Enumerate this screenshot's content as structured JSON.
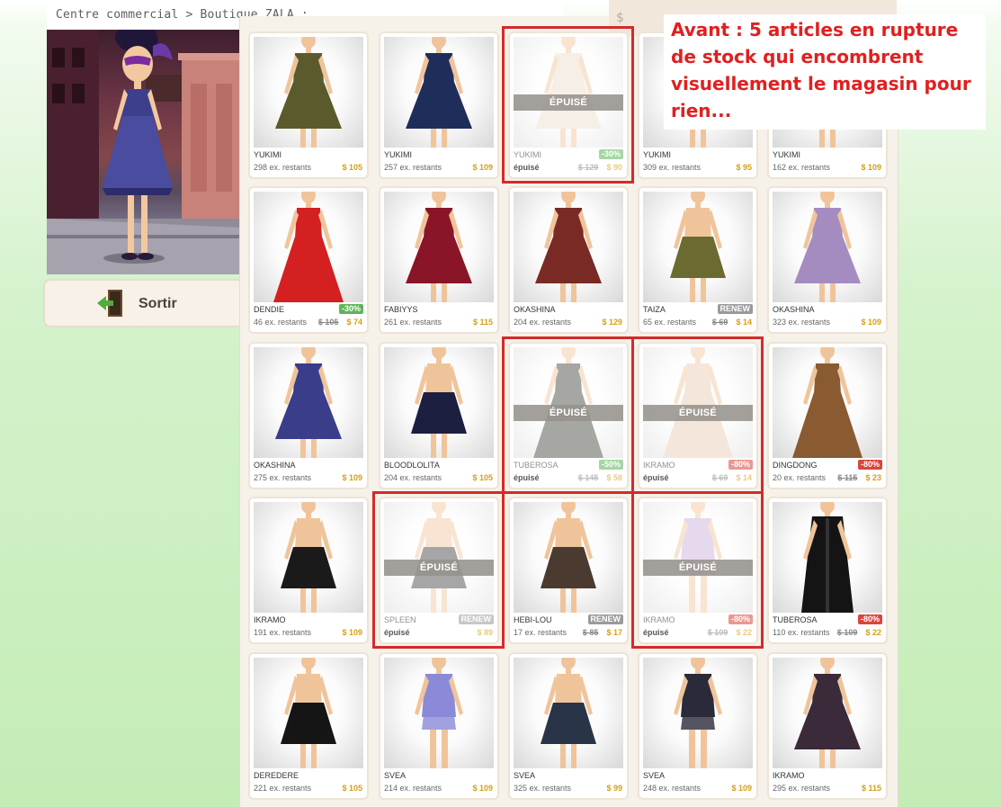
{
  "breadcrumb": "Centre commercial > Boutique ZALA :",
  "exit": {
    "label": "Sortir"
  },
  "top_widget": {
    "symbol": "$"
  },
  "annotation": "Avant : 5 articles en rupture de stock qui encombrent visuellement le magasin pour rien...",
  "sold_out_label": "ÉPUISÉ",
  "products": [
    {
      "name": "YUKIMI",
      "stock": "298 ex. restants",
      "price": "$ 105",
      "old_price": "",
      "badge": "",
      "badge_color": "",
      "sold_out": false,
      "garment": "dress",
      "color": "#5b5a2c"
    },
    {
      "name": "YUKIMI",
      "stock": "257 ex. restants",
      "price": "$ 109",
      "old_price": "",
      "badge": "",
      "badge_color": "",
      "sold_out": false,
      "garment": "dress",
      "color": "#1f2d5a"
    },
    {
      "name": "YUKIMI",
      "stock": "épuisé",
      "price": "$ 90",
      "old_price": "$ 129",
      "badge": "-30%",
      "badge_color": "green",
      "sold_out": true,
      "garment": "dress",
      "color": "#e8dcc8"
    },
    {
      "name": "YUKIMI",
      "stock": "309 ex. restants",
      "price": "$ 95",
      "old_price": "",
      "badge": "",
      "badge_color": "",
      "sold_out": false,
      "garment": "dress",
      "color": "#4d6a9a"
    },
    {
      "name": "YUKIMI",
      "stock": "162 ex. restants",
      "price": "$ 109",
      "old_price": "",
      "badge": "",
      "badge_color": "",
      "sold_out": false,
      "garment": "dress",
      "color": "#8a6b4a"
    },
    {
      "name": "DENDIE",
      "stock": "46 ex. restants",
      "price": "$ 74",
      "old_price": "$ 105",
      "badge": "-30%",
      "badge_color": "green",
      "sold_out": false,
      "garment": "gown",
      "color": "#d42020"
    },
    {
      "name": "FABIYYS",
      "stock": "261 ex. restants",
      "price": "$ 115",
      "old_price": "",
      "badge": "",
      "badge_color": "",
      "sold_out": false,
      "garment": "dress",
      "color": "#8a1528"
    },
    {
      "name": "OKASHINA",
      "stock": "204 ex. restants",
      "price": "$ 129",
      "old_price": "",
      "badge": "",
      "badge_color": "",
      "sold_out": false,
      "garment": "dress",
      "color": "#7a2a24"
    },
    {
      "name": "TAIZA",
      "stock": "65 ex. restants",
      "price": "$ 14",
      "old_price": "$ 69",
      "badge": "RENEW",
      "badge_color": "grey",
      "sold_out": false,
      "garment": "skirt",
      "color": "#6b6a30"
    },
    {
      "name": "OKASHINA",
      "stock": "323 ex. restants",
      "price": "$ 109",
      "old_price": "",
      "badge": "",
      "badge_color": "",
      "sold_out": false,
      "garment": "dress",
      "color": "#a48cc0"
    },
    {
      "name": "OKASHINA",
      "stock": "275 ex. restants",
      "price": "$ 109",
      "old_price": "",
      "badge": "",
      "badge_color": "",
      "sold_out": false,
      "garment": "dress",
      "color": "#3a3d8a"
    },
    {
      "name": "BLOODLOLITA",
      "stock": "204 ex. restants",
      "price": "$ 105",
      "old_price": "",
      "badge": "",
      "badge_color": "",
      "sold_out": false,
      "garment": "skirt",
      "color": "#1c1f40"
    },
    {
      "name": "TUBEROSA",
      "stock": "épuisé",
      "price": "$ 58",
      "old_price": "$ 145",
      "badge": "-50%",
      "badge_color": "green",
      "sold_out": true,
      "garment": "gown",
      "color": "#3a3a32"
    },
    {
      "name": "IKRAMO",
      "stock": "épuisé",
      "price": "$ 14",
      "old_price": "$ 69",
      "badge": "-80%",
      "badge_color": "red",
      "sold_out": true,
      "garment": "gown",
      "color": "#e8c8b0"
    },
    {
      "name": "DINGDONG",
      "stock": "20 ex. restants",
      "price": "$ 23",
      "old_price": "$ 115",
      "badge": "-80%",
      "badge_color": "red",
      "sold_out": false,
      "garment": "gown",
      "color": "#8a5a30"
    },
    {
      "name": "IKRAMO",
      "stock": "191 ex. restants",
      "price": "$ 109",
      "old_price": "",
      "badge": "",
      "badge_color": "",
      "sold_out": false,
      "garment": "skirt",
      "color": "#1a1a1a"
    },
    {
      "name": "SPLEEN",
      "stock": "épuisé",
      "price": "$ 89",
      "old_price": "",
      "badge": "RENEW",
      "badge_color": "grey",
      "sold_out": true,
      "garment": "skirt",
      "color": "#3a3a3a"
    },
    {
      "name": "HEBI-LOU",
      "stock": "17 ex. restants",
      "price": "$ 17",
      "old_price": "$ 85",
      "badge": "RENEW",
      "badge_color": "grey",
      "sold_out": false,
      "garment": "skirt",
      "color": "#4a3a30"
    },
    {
      "name": "IKRAMO",
      "stock": "épuisé",
      "price": "$ 22",
      "old_price": "$ 109",
      "badge": "-80%",
      "badge_color": "red",
      "sold_out": true,
      "garment": "top",
      "color": "#c8a8d8"
    },
    {
      "name": "TUBEROSA",
      "stock": "110 ex. restants",
      "price": "$ 22",
      "old_price": "$ 109",
      "badge": "-80%",
      "badge_color": "red",
      "sold_out": false,
      "garment": "coat",
      "color": "#141414"
    },
    {
      "name": "DEREDERE",
      "stock": "221 ex. restants",
      "price": "$ 105",
      "old_price": "",
      "badge": "",
      "badge_color": "",
      "sold_out": false,
      "garment": "skirt",
      "color": "#151515"
    },
    {
      "name": "SVEA",
      "stock": "214 ex. restants",
      "price": "$ 109",
      "old_price": "",
      "badge": "",
      "badge_color": "",
      "sold_out": false,
      "garment": "top",
      "color": "#8a8ad8"
    },
    {
      "name": "SVEA",
      "stock": "325 ex. restants",
      "price": "$ 99",
      "old_price": "",
      "badge": "",
      "badge_color": "",
      "sold_out": false,
      "garment": "skirt",
      "color": "#2a3448"
    },
    {
      "name": "SVEA",
      "stock": "248 ex. restants",
      "price": "$ 109",
      "old_price": "",
      "badge": "",
      "badge_color": "",
      "sold_out": false,
      "garment": "top",
      "color": "#2a2a3a"
    },
    {
      "name": "IKRAMO",
      "stock": "295 ex. restants",
      "price": "$ 115",
      "old_price": "",
      "badge": "",
      "badge_color": "",
      "sold_out": false,
      "garment": "dress",
      "color": "#3a2a3a"
    }
  ]
}
